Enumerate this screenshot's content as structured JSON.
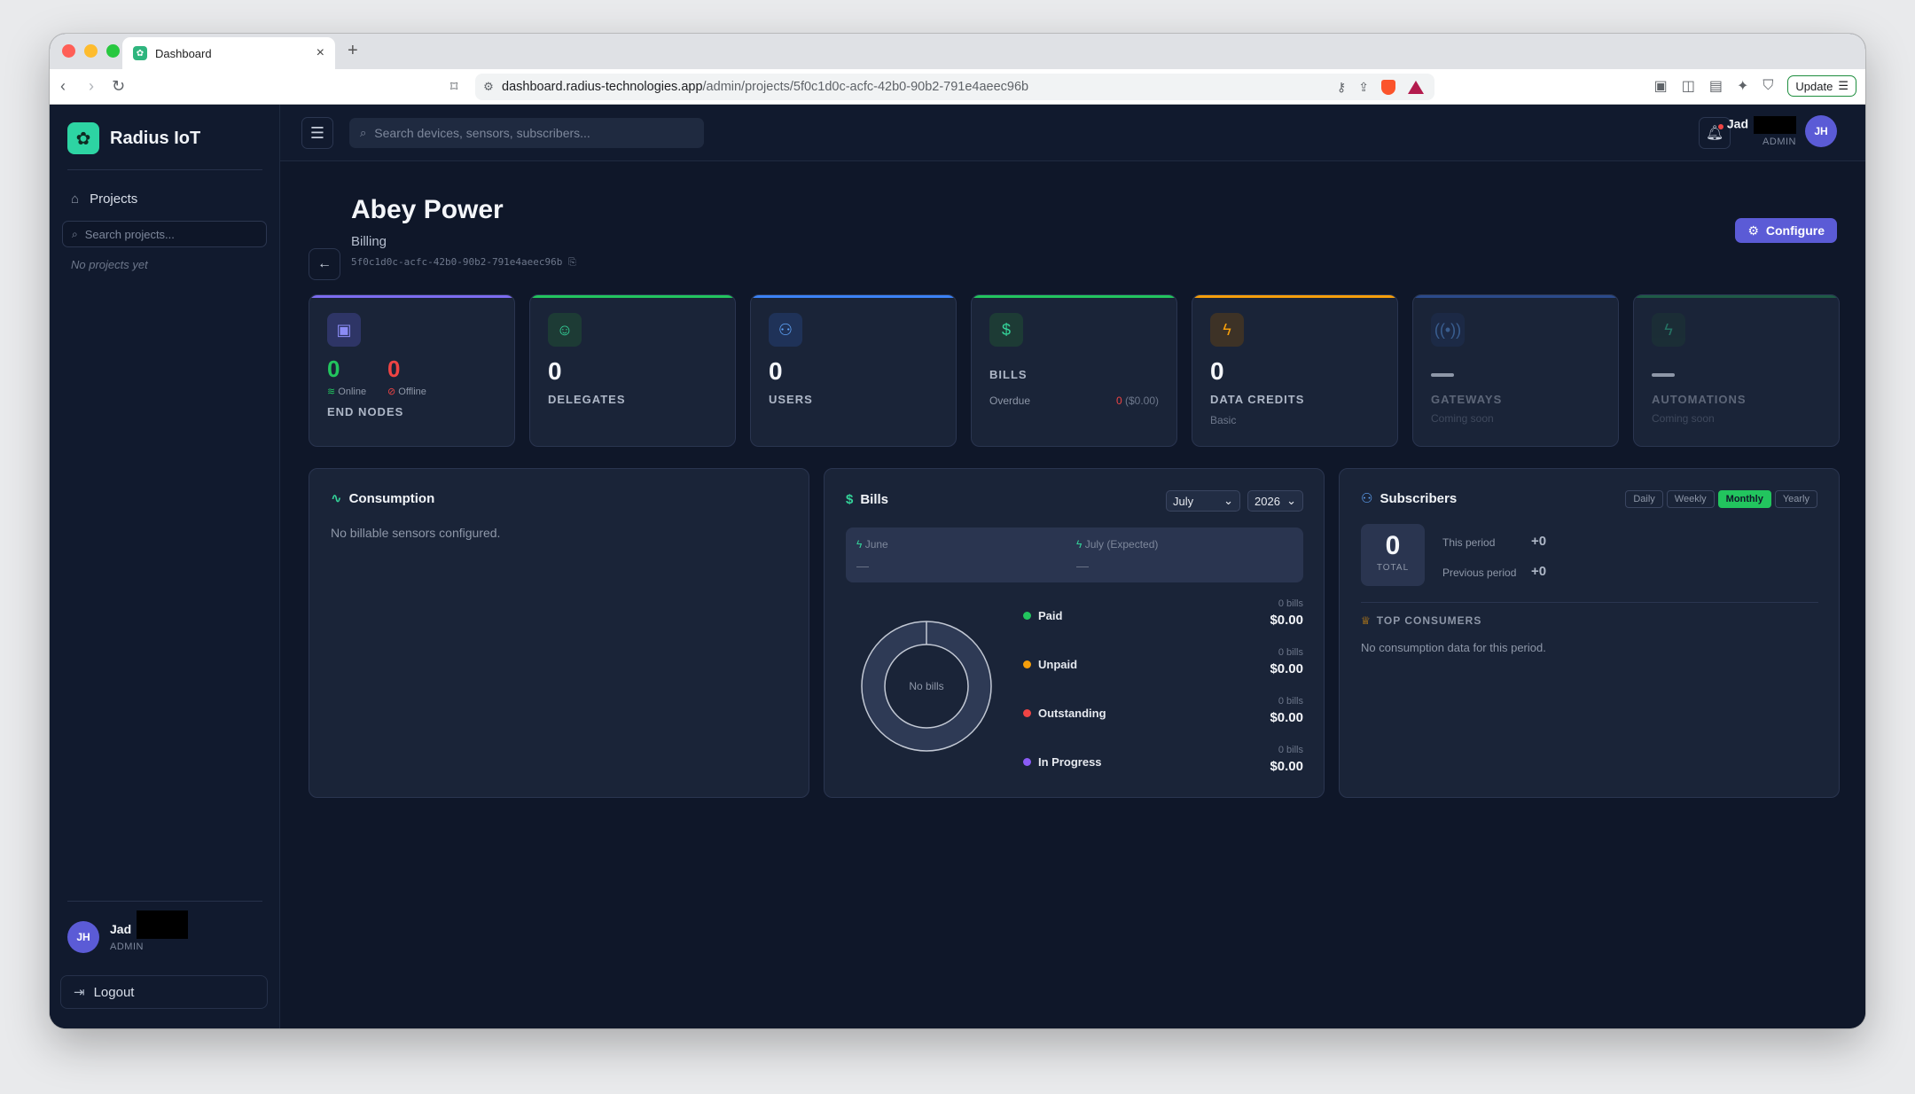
{
  "browser": {
    "tab_title": "Dashboard",
    "url_host": "dashboard.radius-technologies.app",
    "url_path": "/admin/projects/5f0c1d0c-acfc-42b0-90b2-791e4aeec96b",
    "update_label": "Update"
  },
  "sidebar": {
    "brand": "Radius IoT",
    "projects_label": "Projects",
    "search_placeholder": "Search projects...",
    "empty_text": "No projects yet",
    "user_name": "Jad",
    "user_role": "ADMIN",
    "user_initials": "JH",
    "logout_label": "Logout"
  },
  "topbar": {
    "search_placeholder": "Search devices, sensors, subscribers...",
    "user_name": "Jad",
    "user_role": "ADMIN",
    "user_initials": "JH"
  },
  "page": {
    "title": "Abey Power",
    "subtitle": "Billing",
    "project_id": "5f0c1d0c-acfc-42b0-90b2-791e4aeec96b",
    "configure_label": "Configure"
  },
  "cards": {
    "end_nodes": {
      "online": "0",
      "offline": "0",
      "online_label": "Online",
      "offline_label": "Offline",
      "label": "END NODES"
    },
    "delegates": {
      "value": "0",
      "label": "DELEGATES"
    },
    "users": {
      "value": "0",
      "label": "USERS"
    },
    "bills": {
      "label": "BILLS",
      "overdue_label": "Overdue",
      "overdue_count": "0",
      "overdue_amount": "($0.00)"
    },
    "data_credits": {
      "value": "0",
      "label": "DATA CREDITS",
      "sub": "Basic"
    },
    "gateways": {
      "label": "GATEWAYS",
      "sub": "Coming soon"
    },
    "automations": {
      "label": "AUTOMATIONS",
      "sub": "Coming soon"
    }
  },
  "consumption": {
    "title": "Consumption",
    "empty_text": "No billable sensors configured."
  },
  "bills_panel": {
    "title": "Bills",
    "month": "July",
    "year": "2026",
    "prev_label": "June",
    "prev_value": "—",
    "next_label": "July (Expected)",
    "next_value": "—",
    "donut_label": "No bills",
    "legend": [
      {
        "name": "Paid",
        "count": "0 bills",
        "amount": "$0.00",
        "color": "#22c55e"
      },
      {
        "name": "Unpaid",
        "count": "0 bills",
        "amount": "$0.00",
        "color": "#f59e0b"
      },
      {
        "name": "Outstanding",
        "count": "0 bills",
        "amount": "$0.00",
        "color": "#ef4444"
      },
      {
        "name": "In Progress",
        "count": "0 bills",
        "amount": "$0.00",
        "color": "#8b5cf6"
      }
    ]
  },
  "subscribers": {
    "title": "Subscribers",
    "periods": [
      "Daily",
      "Weekly",
      "Monthly",
      "Yearly"
    ],
    "active_period": "Monthly",
    "total": "0",
    "total_label": "TOTAL",
    "this_period_label": "This period",
    "this_period_value": "+0",
    "previous_period_label": "Previous period",
    "previous_period_value": "+0",
    "top_consumers_label": "TOP CONSUMERS",
    "empty_text": "No consumption data for this period."
  },
  "colors": {
    "accent": "#5b5bd6",
    "success": "#22c55e",
    "danger": "#ef4444",
    "warning": "#f59e0b"
  }
}
